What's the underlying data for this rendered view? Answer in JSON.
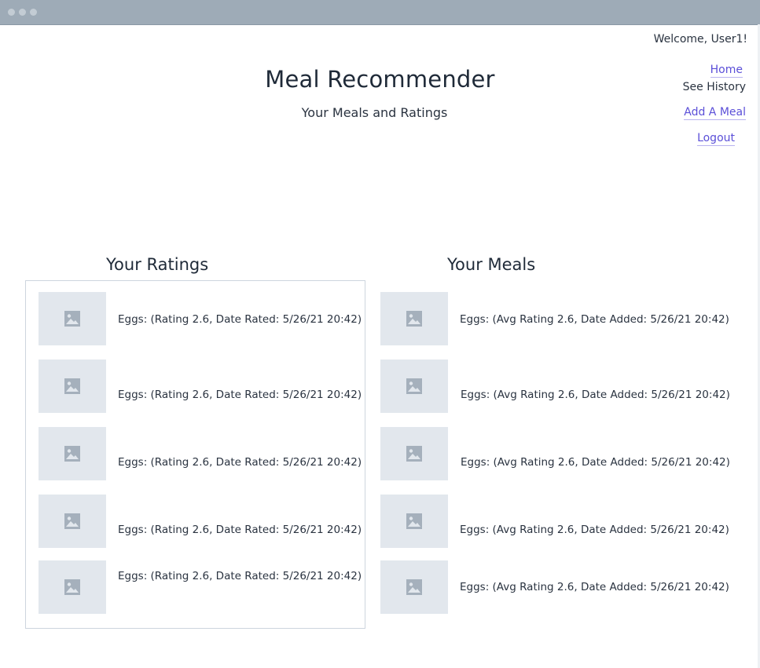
{
  "header": {
    "welcome": "Welcome, User1!",
    "title": "Meal Recommender",
    "subtitle": "Your Meals and Ratings"
  },
  "nav": {
    "home": "Home",
    "history": "See History",
    "add_meal": "Add A Meal",
    "logout": "Logout"
  },
  "ratings": {
    "title": "Your Ratings",
    "items": [
      {
        "text": "Eggs: (Rating 2.6, Date Rated: 5/26/21 20:42)"
      },
      {
        "text": "Eggs: (Rating 2.6, Date Rated: 5/26/21 20:42)"
      },
      {
        "text": "Eggs: (Rating 2.6, Date Rated: 5/26/21 20:42)"
      },
      {
        "text": "Eggs: (Rating 2.6, Date Rated: 5/26/21 20:42)"
      },
      {
        "text": "Eggs: (Rating 2.6, Date Rated: 5/26/21 20:42)"
      }
    ]
  },
  "meals": {
    "title": "Your Meals",
    "items": [
      {
        "text": "Eggs: (Avg Rating 2.6, Date Added: 5/26/21 20:42)"
      },
      {
        "text": "Eggs: (Avg Rating 2.6, Date Added: 5/26/21 20:42)"
      },
      {
        "text": "Eggs: (Avg Rating 2.6, Date Added: 5/26/21 20:42)"
      },
      {
        "text": "Eggs: (Avg Rating 2.6, Date Added: 5/26/21 20:42)"
      },
      {
        "text": "Eggs: (Avg Rating 2.6, Date Added: 5/26/21 20:42)"
      }
    ]
  },
  "icons": {
    "thumbnail": "image-placeholder-icon"
  },
  "colors": {
    "link": "#5b4fd8",
    "titlebar": "#9eabb7",
    "thumbnail_bg": "#e2e7ed",
    "box_border": "#cdd5de"
  }
}
